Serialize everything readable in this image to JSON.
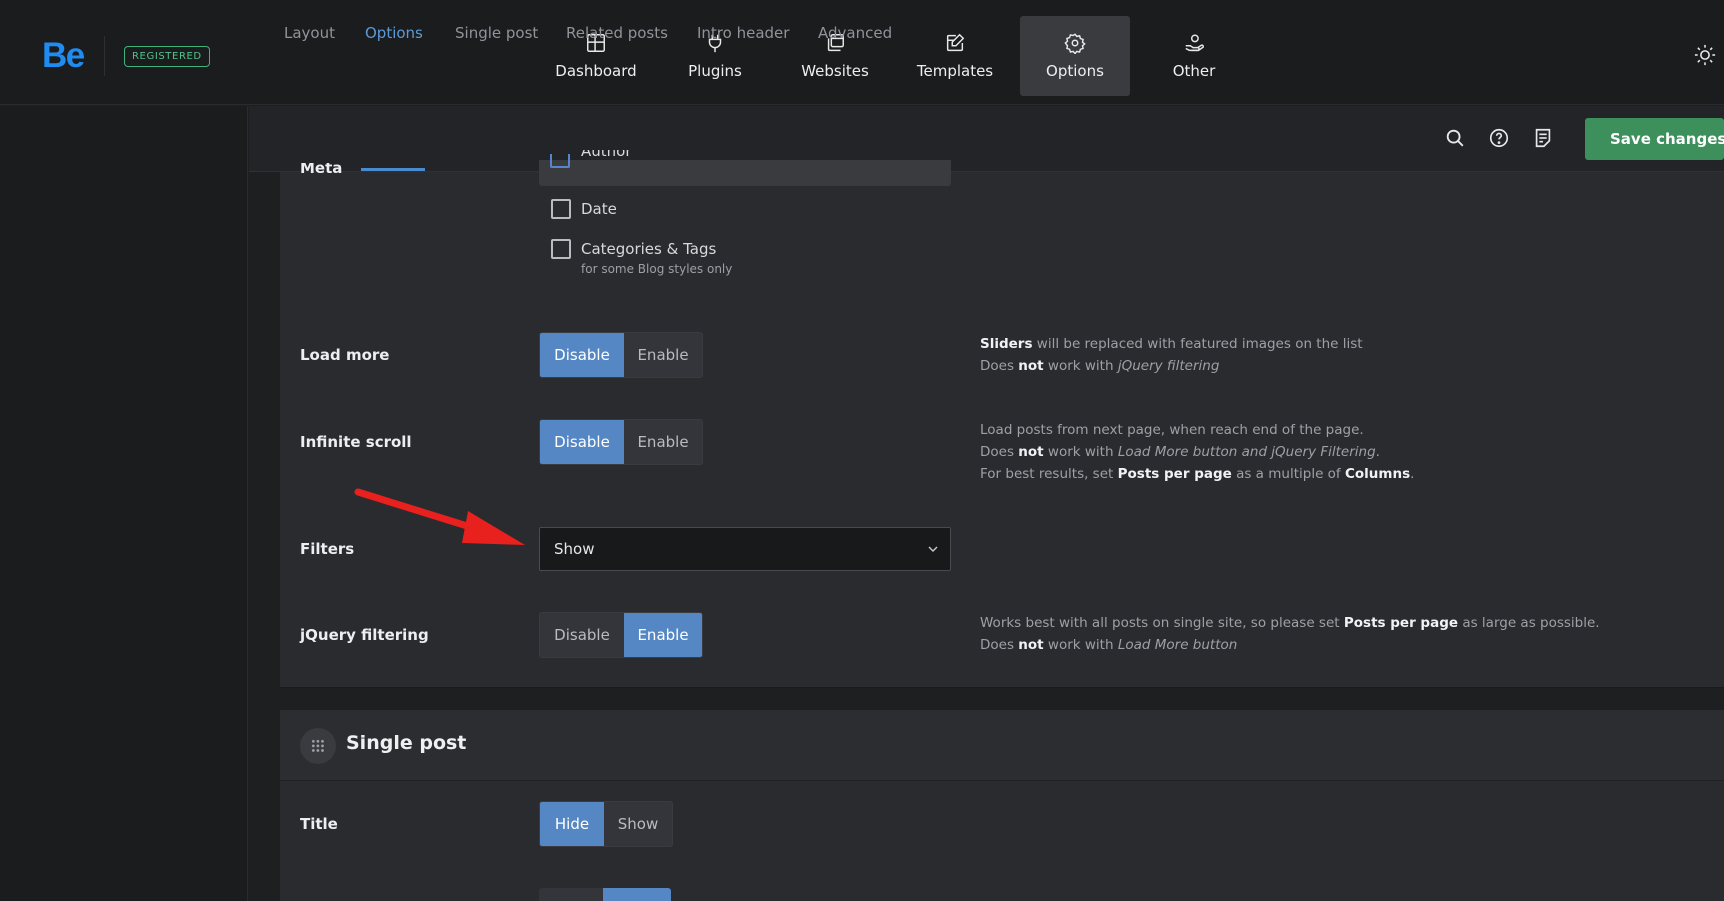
{
  "brand": {
    "logo": "Be",
    "badge": "REGISTERED"
  },
  "nav": [
    {
      "label": "Dashboard",
      "icon": "dashboard-icon"
    },
    {
      "label": "Plugins",
      "icon": "plug-icon"
    },
    {
      "label": "Websites",
      "icon": "websites-icon"
    },
    {
      "label": "Templates",
      "icon": "templates-icon"
    },
    {
      "label": "Options",
      "icon": "gear-icon",
      "active": true
    },
    {
      "label": "Other",
      "icon": "other-icon"
    }
  ],
  "subnav": {
    "tabs": [
      "Layout",
      "Options",
      "Single post",
      "Related posts",
      "Intro header",
      "Advanced"
    ],
    "active_tab": "Options",
    "save_label": "Save changes"
  },
  "colors": {
    "accent": "#5487c4",
    "save": "#3d8f5c",
    "badge": "#3fb37a",
    "brand": "#1e8cf0",
    "arrow": "#e8201e"
  },
  "meta": {
    "label": "Meta",
    "partial_item": "Author",
    "items": [
      {
        "label": "Date",
        "checked": false
      },
      {
        "label": "Categories & Tags",
        "sub": "for some Blog styles only",
        "checked": false
      }
    ]
  },
  "load_more": {
    "label": "Load more",
    "options": [
      "Disable",
      "Enable"
    ],
    "selected": "Disable",
    "desc": {
      "l1_b": "Sliders",
      "l1": " will be replaced with featured images on the list",
      "l2_a": "Does ",
      "l2_b": "not",
      "l2_c": " work with ",
      "l2_i": "jQuery filtering"
    }
  },
  "infinite_scroll": {
    "label": "Infinite scroll",
    "options": [
      "Disable",
      "Enable"
    ],
    "selected": "Disable",
    "desc": {
      "l1": "Load posts from next page, when reach end of the page.",
      "l2_a": "Does ",
      "l2_b": "not",
      "l2_c": " work with ",
      "l2_i": "Load More button and jQuery Filtering",
      "l2_d": ".",
      "l3_a": "For best results, set ",
      "l3_b": "Posts per page",
      "l3_c": " as a multiple of ",
      "l3_d": "Columns",
      "l3_e": "."
    }
  },
  "filters": {
    "label": "Filters",
    "value": "Show"
  },
  "jquery_filtering": {
    "label": "jQuery filtering",
    "options": [
      "Disable",
      "Enable"
    ],
    "selected": "Enable",
    "desc": {
      "l1_a": "Works best with all posts on single site, so please set ",
      "l1_b": "Posts per page",
      "l1_c": " as large as possible.",
      "l2_a": "Does ",
      "l2_b": "not",
      "l2_c": " work with ",
      "l2_i": "Load More button"
    }
  },
  "single_post": {
    "title": "Single post",
    "title_row": {
      "label": "Title",
      "options": [
        "Hide",
        "Show"
      ],
      "selected": "Hide"
    }
  }
}
